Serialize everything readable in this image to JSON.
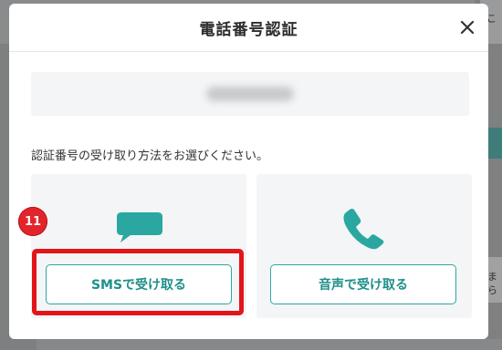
{
  "modal": {
    "title": "電話番号認証",
    "close_icon": "close-icon",
    "phone_number_blurred": true,
    "instruction": "認証番号の受け取り方法をお選びください。",
    "options": [
      {
        "label": "SMSで受け取る",
        "icon": "chat-bubble-icon"
      },
      {
        "label": "音声で受け取る",
        "icon": "phone-icon"
      }
    ],
    "accent_color": "#2aa7a1"
  },
  "annotation": {
    "step_number": "11",
    "highlight_color": "#e3151a"
  },
  "background": {
    "right_edge_text_top": "こ",
    "right_edge_text_bottom_1": "ま",
    "right_edge_text_bottom_2": "ら"
  }
}
